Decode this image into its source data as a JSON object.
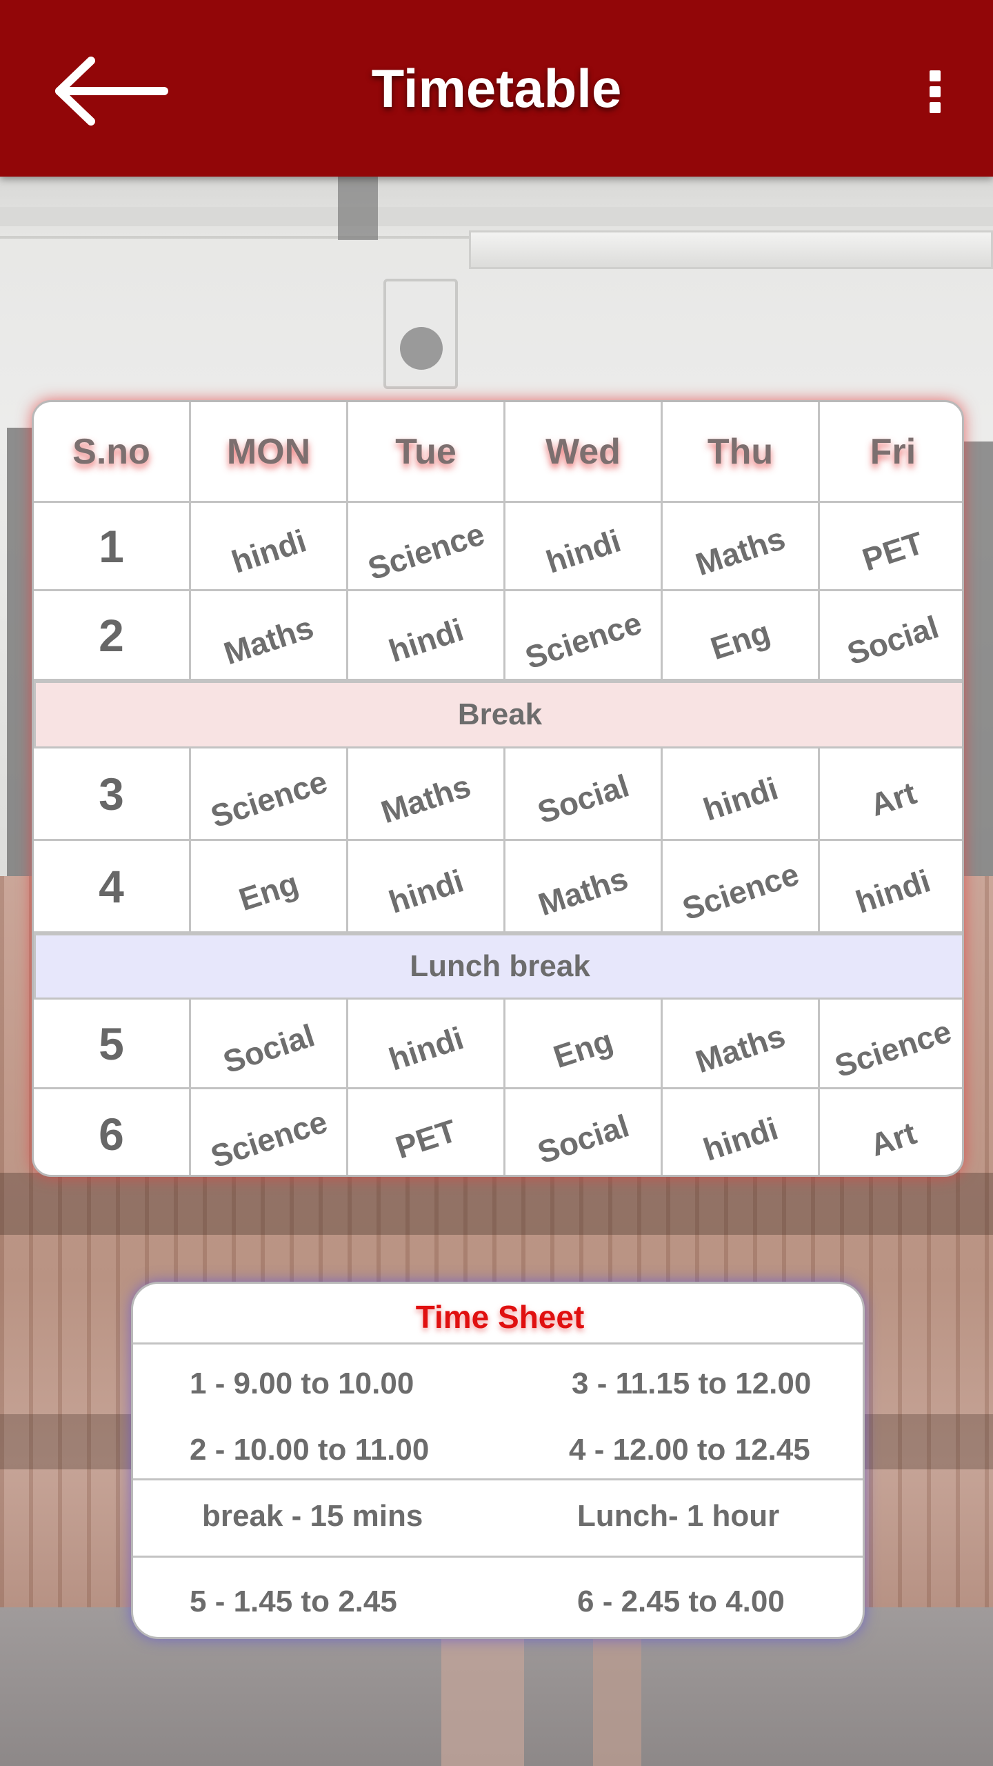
{
  "app_bar": {
    "title": "Timetable",
    "back_icon": "arrow-left-icon",
    "menu_icon": "more-vert-icon",
    "color": "#920608"
  },
  "timetable": {
    "headers": [
      "S.no",
      "MON",
      "Tue",
      "Wed",
      "Thu",
      "Fri"
    ],
    "periods": [
      {
        "no": "1",
        "subjects": [
          "hindi",
          "Science",
          "hindi",
          "Maths",
          "PET"
        ]
      },
      {
        "no": "2",
        "subjects": [
          "Maths",
          "hindi",
          "Science",
          "Eng",
          "Social"
        ]
      },
      {
        "no": "3",
        "subjects": [
          "Science",
          "Maths",
          "Social",
          "hindi",
          "Art"
        ]
      },
      {
        "no": "4",
        "subjects": [
          "Eng",
          "hindi",
          "Maths",
          "Science",
          "hindi"
        ]
      },
      {
        "no": "5",
        "subjects": [
          "Social",
          "hindi",
          "Eng",
          "Maths",
          "Science"
        ]
      },
      {
        "no": "6",
        "subjects": [
          "Science",
          "PET",
          "Social",
          "hindi",
          "Art"
        ]
      }
    ],
    "break_label": "Break",
    "lunch_label": "Lunch break",
    "break_color": "#f8e3e3",
    "lunch_color": "#e7e7fb"
  },
  "time_sheet": {
    "title": "Time Sheet",
    "title_color": "#e01010",
    "p1": "1 - 9.00 to 10.00",
    "p2": "2 - 10.00 to 11.00",
    "p3": "3 - 11.15 to 12.00",
    "p4": "4 - 12.00 to 12.45",
    "break": "break - 15 mins",
    "lunch": "Lunch- 1 hour",
    "p5": "5 - 1.45 to 2.45",
    "p6": "6 - 2.45 to 4.00"
  }
}
